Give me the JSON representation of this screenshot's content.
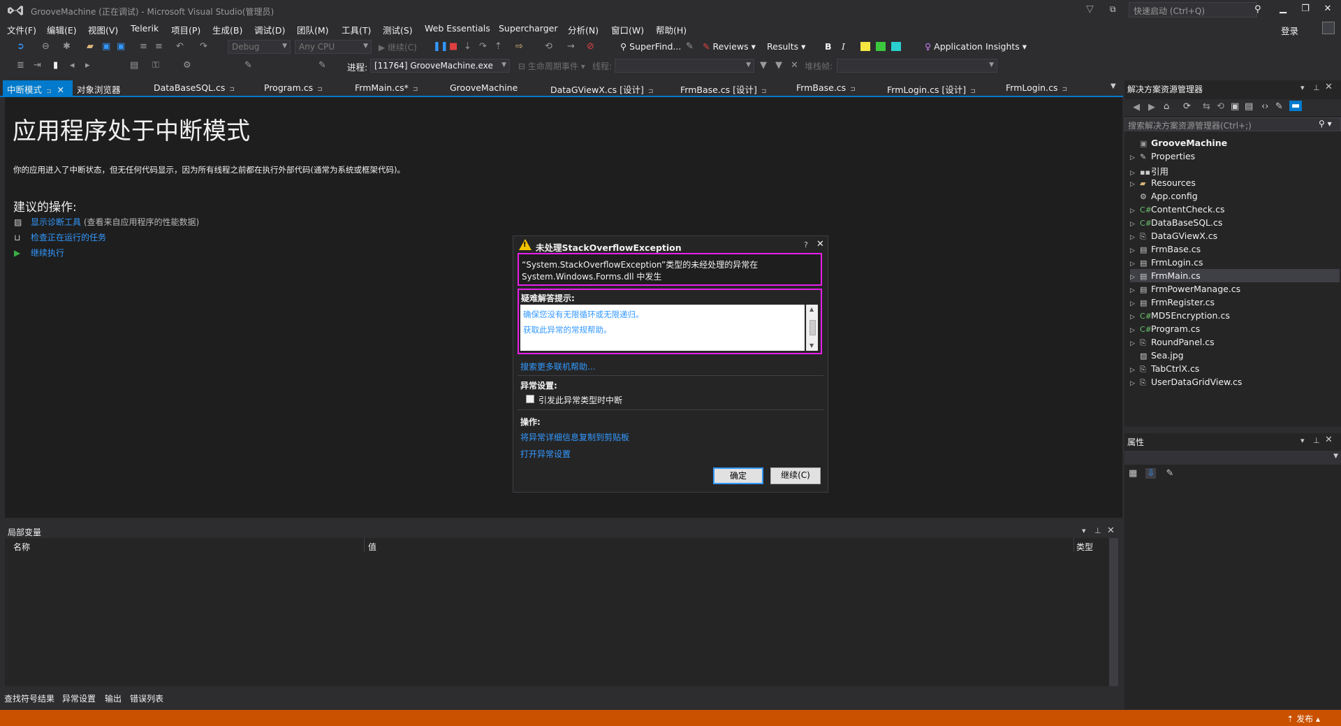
{
  "window": {
    "title": "GrooveMachine (正在调试) - Microsoft Visual Studio(管理员)",
    "quick_launch_placeholder": "快速启动 (Ctrl+Q)",
    "login": "登录"
  },
  "menu": [
    "文件(F)",
    "编辑(E)",
    "视图(V)",
    "Telerik",
    "项目(P)",
    "生成(B)",
    "调试(D)",
    "团队(M)",
    "工具(T)",
    "测试(S)",
    "Web Essentials",
    "Supercharger",
    "分析(N)",
    "窗口(W)",
    "帮助(H)"
  ],
  "toolbar": {
    "config": "Debug",
    "platform": "Any CPU",
    "continue": "继续(C)",
    "superfind": "SuperFind...",
    "reviews": "Reviews",
    "results": "Results",
    "bold": "B",
    "italic": "I",
    "app_insights": "Application Insights",
    "process_label": "进程:",
    "process_value": "[11764] GrooveMachine.exe",
    "lifecycle": "生命周期事件",
    "thread_label": "线程:",
    "stackframe_label": "堆栈帧:"
  },
  "tabs": [
    {
      "label": "中断模式",
      "active": true
    },
    {
      "label": "对象浏览器"
    },
    {
      "label": "DataBaseSQL.cs"
    },
    {
      "label": "Program.cs"
    },
    {
      "label": "FrmMain.cs*"
    },
    {
      "label": "GrooveMachine"
    },
    {
      "label": "DataGViewX.cs [设计]"
    },
    {
      "label": "FrmBase.cs [设计]"
    },
    {
      "label": "FrmBase.cs"
    },
    {
      "label": "FrmLogin.cs [设计]"
    },
    {
      "label": "FrmLogin.cs"
    }
  ],
  "break_mode": {
    "title": "应用程序处于中断模式",
    "description": "你的应用进入了中断状态，但无任何代码显示，因为所有线程之前都在执行外部代码(通常为系统或框架代码)。",
    "actions_heading": "建议的操作:",
    "actions": [
      {
        "link": "显示诊断工具",
        "note": "(查看来自应用程序的性能数据)"
      },
      {
        "link": "检查正在运行的任务",
        "note": ""
      },
      {
        "link": "继续执行",
        "note": ""
      }
    ]
  },
  "dialog": {
    "title": "未处理StackOverflowException",
    "help": "?",
    "message_line1": "“System.StackOverflowException”类型的未经处理的异常在",
    "message_line2": "System.Windows.Forms.dll 中发生",
    "hints_heading": "疑难解答提示:",
    "hints": [
      "确保您没有无限循环或无限递归。",
      "获取此异常的常规帮助。"
    ],
    "search_more": "搜索更多联机帮助...",
    "exception_settings_heading": "异常设置:",
    "break_checkbox_label": "引发此异常类型时中断",
    "break_checked": false,
    "actions_heading": "操作:",
    "copy_details": "将异常详细信息复制到剪贴板",
    "open_settings": "打开异常设置",
    "ok": "确定",
    "continue": "继续(C)"
  },
  "locals": {
    "title": "局部变量",
    "columns": [
      "名称",
      "值",
      "类型"
    ]
  },
  "bottom_tabs": [
    "查找符号结果",
    "异常设置",
    "输出",
    "错误列表"
  ],
  "status": {
    "publish": "发布"
  },
  "solution_explorer": {
    "title": "解决方案资源管理器",
    "search_placeholder": "搜索解决方案资源管理器(Ctrl+;)",
    "items": [
      {
        "label": "GrooveMachine",
        "icon": "csharp-project-icon",
        "root": true
      },
      {
        "label": "Properties",
        "icon": "wrench-icon"
      },
      {
        "label": "引用",
        "icon": "references-icon"
      },
      {
        "label": "Resources",
        "icon": "folder-icon"
      },
      {
        "label": "App.config",
        "icon": "config-file-icon"
      },
      {
        "label": "ContentCheck.cs",
        "icon": "csharp-file-icon"
      },
      {
        "label": "DataBaseSQL.cs",
        "icon": "csharp-file-icon"
      },
      {
        "label": "DataGViewX.cs",
        "icon": "component-icon"
      },
      {
        "label": "FrmBase.cs",
        "icon": "form-icon"
      },
      {
        "label": "FrmLogin.cs",
        "icon": "form-icon"
      },
      {
        "label": "FrmMain.cs",
        "icon": "form-icon",
        "selected": true
      },
      {
        "label": "FrmPowerManage.cs",
        "icon": "form-icon"
      },
      {
        "label": "FrmRegister.cs",
        "icon": "form-icon"
      },
      {
        "label": "MD5Encryption.cs",
        "icon": "csharp-file-icon"
      },
      {
        "label": "Program.cs",
        "icon": "csharp-file-icon"
      },
      {
        "label": "RoundPanel.cs",
        "icon": "component-icon"
      },
      {
        "label": "Sea.jpg",
        "icon": "image-file-icon"
      },
      {
        "label": "TabCtrlX.cs",
        "icon": "component-icon"
      },
      {
        "label": "UserDataGridView.cs",
        "icon": "component-icon"
      }
    ]
  },
  "properties": {
    "title": "属性"
  },
  "colors": {
    "accent": "#007acc",
    "status_bar": "#ca5100",
    "highlight_box": "#e91ee9",
    "link": "#3399ff"
  }
}
